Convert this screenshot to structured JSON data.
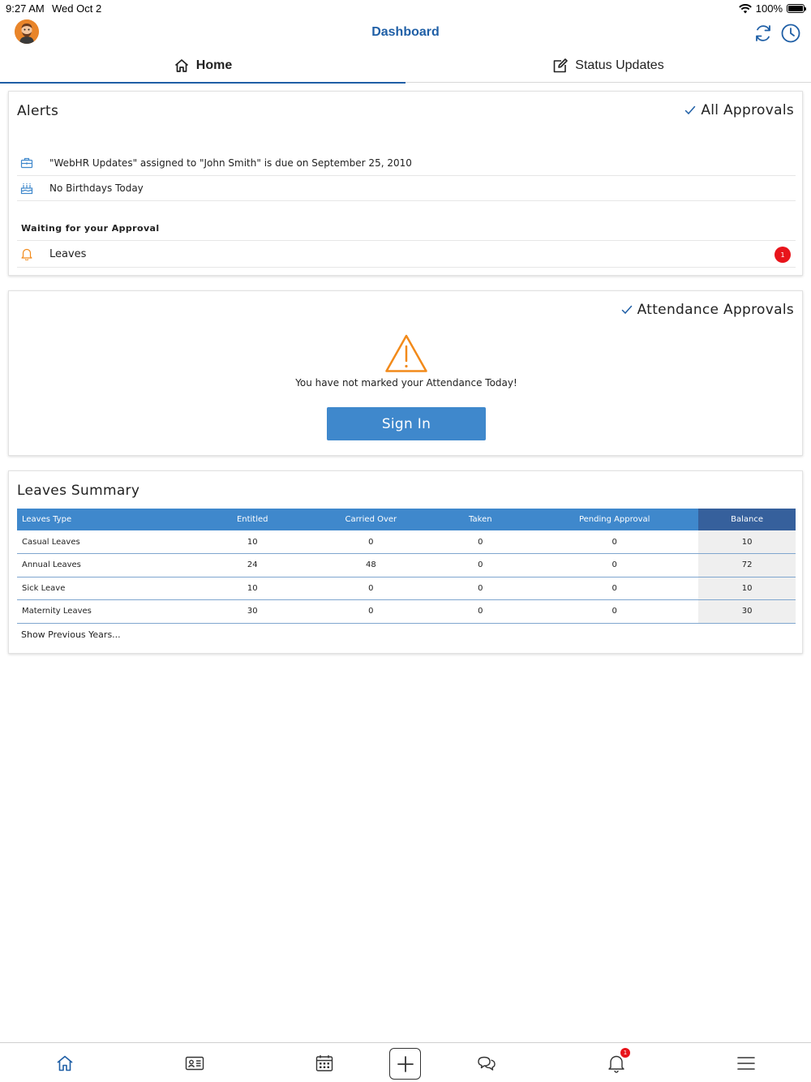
{
  "status_bar": {
    "time": "9:27 AM",
    "date": "Wed Oct 2",
    "battery": "100%"
  },
  "nav": {
    "title": "Dashboard"
  },
  "tabs": [
    {
      "label": "Home",
      "active": true
    },
    {
      "label": "Status Updates",
      "active": false
    }
  ],
  "alerts": {
    "title": "Alerts",
    "link": "All Approvals",
    "items": [
      {
        "icon": "briefcase-icon",
        "text": "\"WebHR Updates\" assigned to \"John Smith\" is due on September 25, 2010"
      },
      {
        "icon": "cake-icon",
        "text": "No Birthdays Today"
      }
    ],
    "waiting_title": "Waiting for your Approval",
    "waiting_item": {
      "label": "Leaves",
      "count": "1"
    }
  },
  "attendance": {
    "link": "Attendance Approvals",
    "message": "You have not marked your Attendance Today!",
    "button": "Sign In"
  },
  "leaves_summary": {
    "title": "Leaves Summary",
    "columns": [
      "Leaves Type",
      "Entitled",
      "Carried Over",
      "Taken",
      "Pending Approval",
      "Balance"
    ],
    "rows": [
      [
        "Casual Leaves",
        "10",
        "0",
        "0",
        "0",
        "10"
      ],
      [
        "Annual Leaves",
        "24",
        "48",
        "0",
        "0",
        "72"
      ],
      [
        "Sick Leave",
        "10",
        "0",
        "0",
        "0",
        "10"
      ],
      [
        "Maternity Leaves",
        "30",
        "0",
        "0",
        "0",
        "30"
      ]
    ],
    "footer_link": "Show Previous Years..."
  },
  "tabbar": {
    "items": [
      "home-icon",
      "contact-card-icon",
      "calendar-icon",
      "plus-icon",
      "chat-icon",
      "bell-icon",
      "menu-icon"
    ],
    "notification_count": "1"
  },
  "colors": {
    "brand_blue": "#1f5fa6",
    "table_header": "#3f88cc",
    "balance_header": "#36609c",
    "alert_red": "#e8141b",
    "warning_orange": "#f28a1a"
  }
}
